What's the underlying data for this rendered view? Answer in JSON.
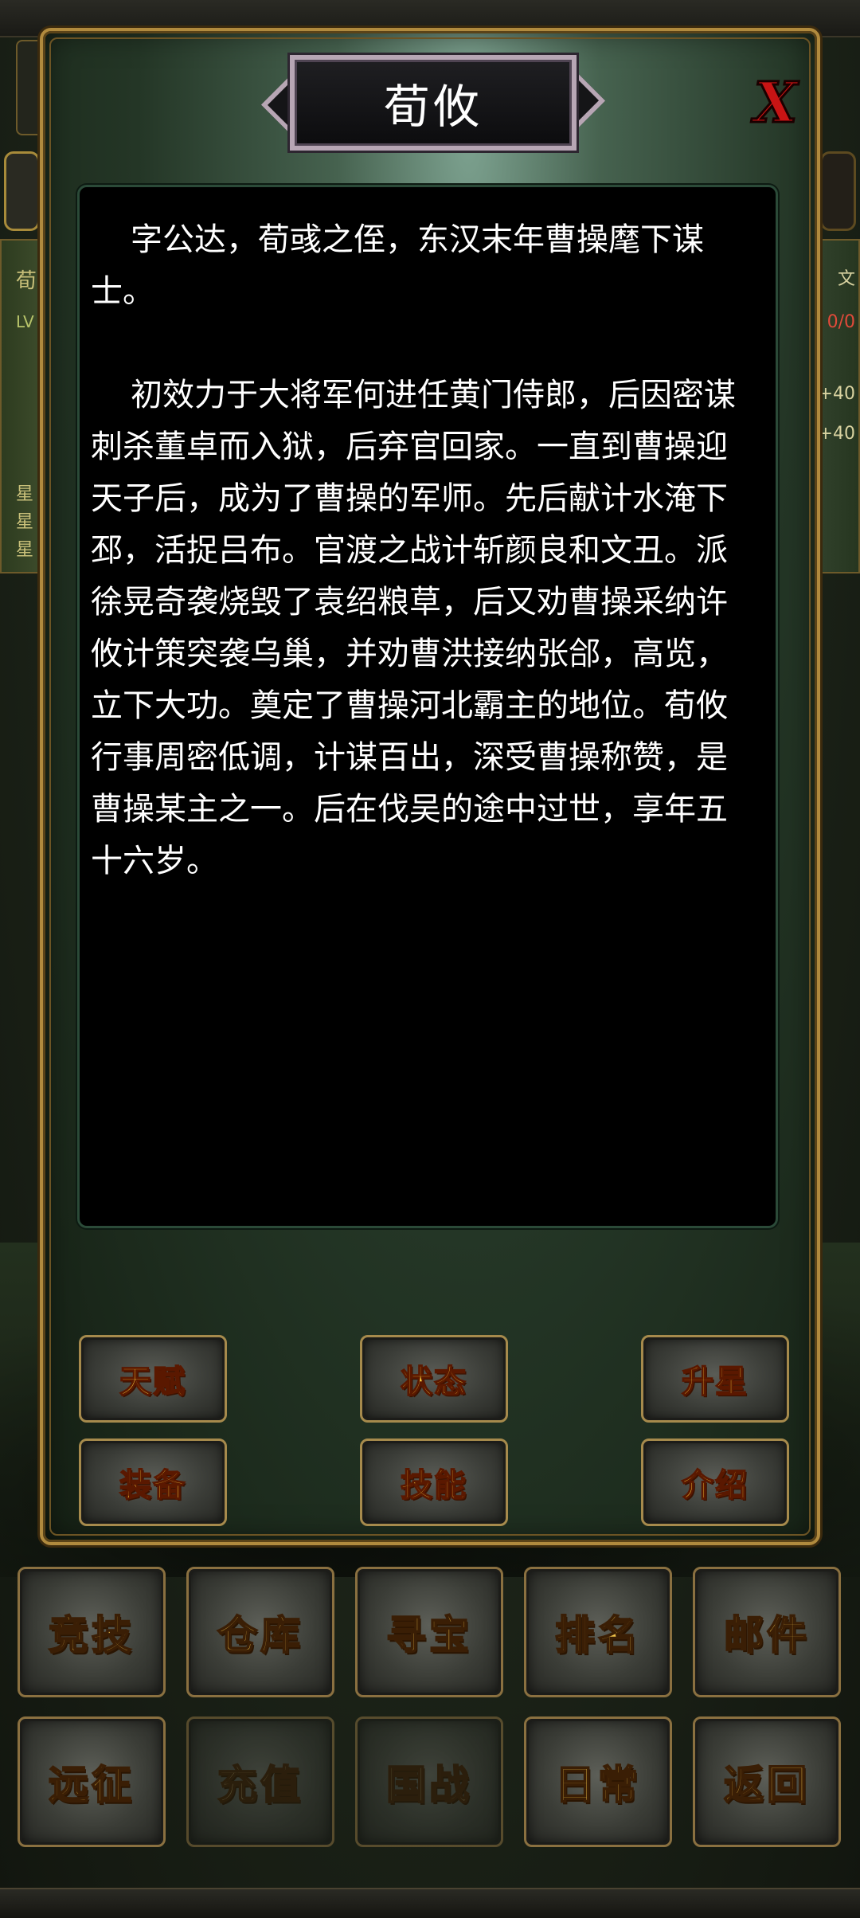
{
  "background": {
    "left_strip_chars": [
      "荀",
      "LV",
      "星",
      "星",
      "星"
    ],
    "right_strip_texts": [
      "文",
      "0/0",
      "+40",
      "+40"
    ]
  },
  "modal": {
    "title": "荀攸",
    "close_glyph": "X",
    "description": [
      "字公达，荀彧之侄，东汉末年曹操麾下谋士。",
      "初效力于大将军何进任黄门侍郎，后因密谋刺杀董卓而入狱，后弃官回家。一直到曹操迎天子后，成为了曹操的军师。先后献计水淹下邳，活捉吕布。官渡之战计斩颜良和文丑。派徐晃奇袭烧毁了袁绍粮草，后又劝曹操采纳许攸计策突袭乌巢，并劝曹洪接纳张郃，高览，立下大功。奠定了曹操河北霸主的地位。荀攸行事周密低调，计谋百出，深受曹操称赞，是曹操某主之一。后在伐吴的途中过世，享年五十六岁。"
    ],
    "buttons": {
      "talent": "天赋",
      "status": "状态",
      "star_up": "升星",
      "equipment": "装备",
      "skill": "技能",
      "intro": "介绍"
    }
  },
  "bottom_menu": {
    "row1": [
      "竞技",
      "仓库",
      "寻宝",
      "排名",
      "邮件"
    ],
    "row2": [
      "远征",
      "充值",
      "国战",
      "日常",
      "返回"
    ]
  },
  "colors": {
    "modal_border": "#b08a3e",
    "button_text": "#ffd23c",
    "menu_text": "#f0c24a",
    "close_red": "#c81414",
    "panel_bg": "#000000"
  }
}
